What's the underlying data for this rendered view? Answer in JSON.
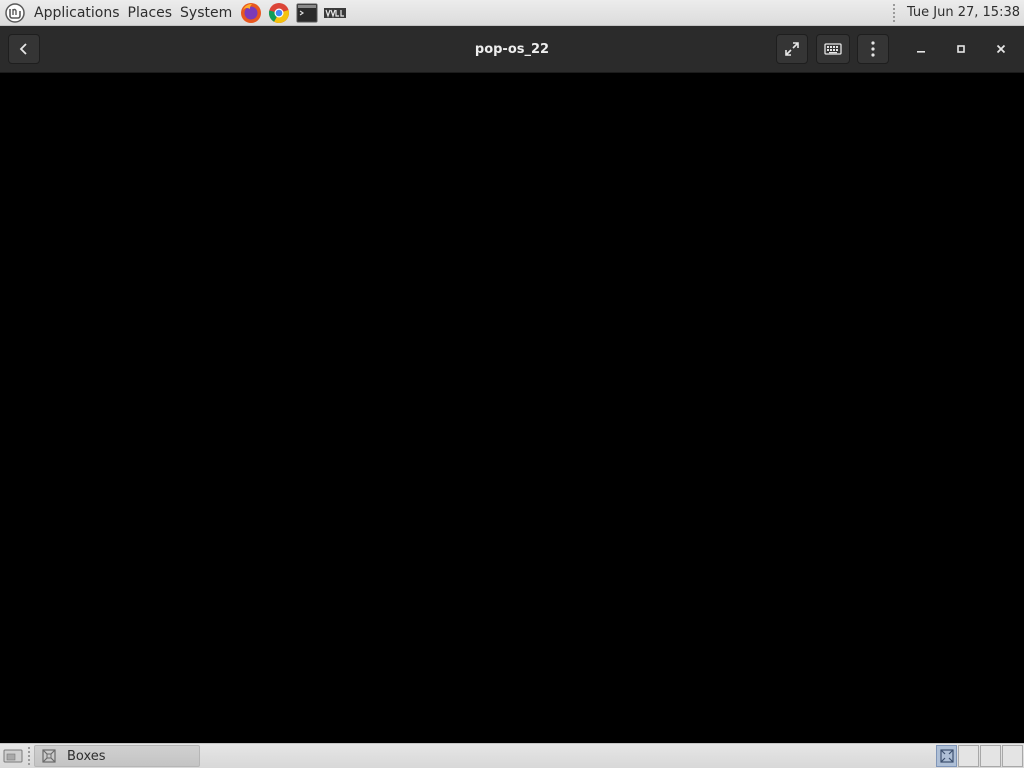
{
  "top_panel": {
    "menus": [
      "Applications",
      "Places",
      "System"
    ],
    "launchers": [
      "firefox-icon",
      "chrome-icon",
      "terminal-icon",
      "virt-manager-icon"
    ],
    "clock": "Tue Jun 27, 15:38"
  },
  "headerbar": {
    "title": "pop-os_22",
    "buttons": [
      "back-icon",
      "fullscreen-icon",
      "keyboard-icon",
      "menu-icon",
      "minimize-icon",
      "maximize-icon",
      "close-icon"
    ]
  },
  "taskbar": {
    "task_label": "Boxes",
    "workspaces": 4,
    "active_workspace": 1
  },
  "colors": {
    "panel_bg": "#dcdcdc",
    "headerbar_bg": "#2b2b2b",
    "display_bg": "#000000",
    "workspace_active": "#aebfd6"
  }
}
